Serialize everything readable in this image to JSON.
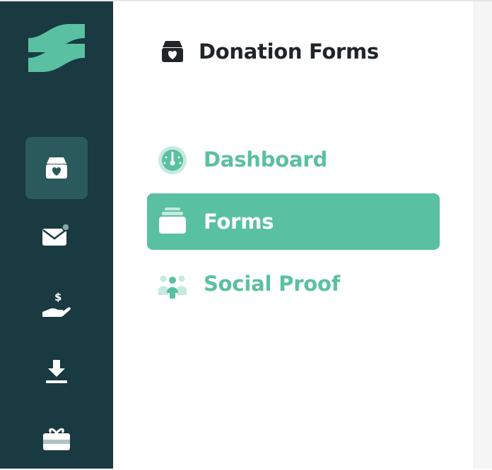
{
  "header": {
    "title": "Donation Forms",
    "icon": "donation-box-icon"
  },
  "rail": {
    "items": [
      {
        "name": "donation-forms",
        "icon": "donation-box-icon",
        "active": true
      },
      {
        "name": "messages",
        "icon": "envelope-icon",
        "has_badge": true
      },
      {
        "name": "donations",
        "icon": "hand-dollar-icon"
      },
      {
        "name": "export",
        "icon": "download-icon"
      },
      {
        "name": "gifts",
        "icon": "gift-icon"
      }
    ]
  },
  "nav": {
    "items": [
      {
        "label": "Dashboard",
        "icon": "gauge-icon",
        "active": false
      },
      {
        "label": "Forms",
        "icon": "forms-stack-icon",
        "active": true
      },
      {
        "label": "Social Proof",
        "icon": "people-group-icon",
        "active": false
      }
    ]
  },
  "colors": {
    "rail_bg": "#183a40",
    "rail_active": "#2a5a5b",
    "accent": "#5ac0a2",
    "title_text": "#1f2528"
  }
}
